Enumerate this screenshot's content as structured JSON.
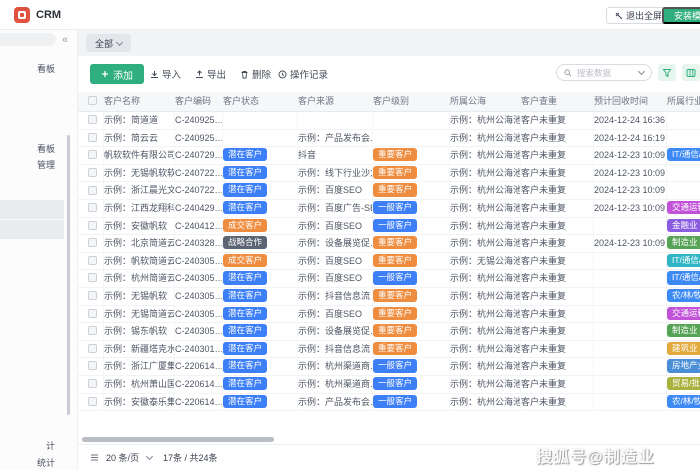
{
  "topbar": {
    "app_name": "CRM",
    "exit_fullscreen": "退出全屏",
    "install_template": "安装模板"
  },
  "tabs": {
    "active": "全部"
  },
  "sidebar": {
    "items": [
      "看板",
      "看板",
      "管理",
      "计",
      "统计"
    ]
  },
  "toolbar": {
    "add": "添加",
    "import": "导入",
    "export": "导出",
    "delete": "删除",
    "history": "操作记录"
  },
  "search": {
    "placeholder": "搜索数据"
  },
  "colors": {
    "primary_green": "#2fae7f",
    "logo_red": "#e0523f",
    "status_potential": "#3d7ff7",
    "status_deal": "#ee8c3f",
    "status_strategic": "#5a6472",
    "level_important": "#ee8c3f",
    "level_general": "#3d7ff7"
  },
  "table": {
    "headers": [
      "客户名称",
      "客户编码",
      "客户状态",
      "客户来源",
      "客户级别",
      "所属公海",
      "客户查重",
      "预计回收时间",
      "所属行业"
    ],
    "rows": [
      {
        "name": "示例：简道道",
        "code": "C-240925…",
        "status": "",
        "status_color": "",
        "source": "",
        "level": "",
        "level_color": "",
        "pool": "示例：杭州公海池",
        "dup": "客户未重复",
        "time": "2024-12-24 16:36…",
        "industry": "",
        "industry_color": ""
      },
      {
        "name": "示例：简云云",
        "code": "C-240925…",
        "status": "",
        "status_color": "",
        "source": "示例：产品发布会…",
        "level": "",
        "level_color": "",
        "pool": "示例：杭州公海池",
        "dup": "客户未重复",
        "time": "2024-12-24 16:19…",
        "industry": "",
        "industry_color": ""
      },
      {
        "name": "帆软软件有限公司",
        "code": "C-240729…",
        "status": "潜在客户",
        "status_color": "#3d7ff7",
        "source": "抖音",
        "level": "重要客户",
        "level_color": "#ee8c3f",
        "pool": "示例：杭州公海池",
        "dup": "客户未重复",
        "time": "2024-12-23 10:09…",
        "industry": "IT/通信/",
        "industry_color": "#3d8af5"
      },
      {
        "name": "示例：无锡帆软软件",
        "code": "C-240722…",
        "status": "潜在客户",
        "status_color": "#3d7ff7",
        "source": "示例：线下行业沙龙",
        "level": "重要客户",
        "level_color": "#ee8c3f",
        "pool": "示例：杭州公海池",
        "dup": "客户未重复",
        "time": "2024-12-23 10:09…",
        "industry": "",
        "industry_color": ""
      },
      {
        "name": "示例：浙江晨光文…",
        "code": "C-240722…",
        "status": "潜在客户",
        "status_color": "#3d7ff7",
        "source": "示例：百度SEO",
        "level": "重要客户",
        "level_color": "#ee8c3f",
        "pool": "示例：杭州公海池",
        "dup": "客户未重复",
        "time": "2024-12-23 10:09…",
        "industry": "",
        "industry_color": ""
      },
      {
        "name": "示例：江西龙翔科…",
        "code": "C-240429…",
        "status": "潜在客户",
        "status_color": "#3d7ff7",
        "source": "示例：百度广告-SEM",
        "level": "一般客户",
        "level_color": "#3d7ff7",
        "pool": "示例：杭州公海池",
        "dup": "客户未重复",
        "time": "2024-12-23 10:09…",
        "industry": "交通运输",
        "industry_color": "#c152d8"
      },
      {
        "name": "示例：安徽帆软",
        "code": "C-240412…",
        "status": "成交客户",
        "status_color": "#ee8c3f",
        "source": "示例：百度SEO",
        "level": "一般客户",
        "level_color": "#3d7ff7",
        "pool": "示例：杭州公海池",
        "dup": "客户未重复",
        "time": "",
        "industry": "金融业",
        "industry_color": "#8a5ce0"
      },
      {
        "name": "示例：北京简道云…",
        "code": "C-240328…",
        "status": "战略合作",
        "status_color": "#5a6472",
        "source": "示例：设备展览促…",
        "level": "重要客户",
        "level_color": "#ee8c3f",
        "pool": "示例：杭州公海池",
        "dup": "客户未重复",
        "time": "2024-12-23 10:09…",
        "industry": "制造业",
        "industry_color": "#55a355"
      },
      {
        "name": "示例：帆软简道云",
        "code": "C-240305…",
        "status": "成交客户",
        "status_color": "#ee8c3f",
        "source": "示例：百度SEO",
        "level": "重要客户",
        "level_color": "#ee8c3f",
        "pool": "示例：无锡公海池",
        "dup": "客户未重复",
        "time": "",
        "industry": "IT/通信/",
        "industry_color": "#2fb5c4"
      },
      {
        "name": "示例：杭州简道云",
        "code": "C-240305…",
        "status": "潜在客户",
        "status_color": "#3d7ff7",
        "source": "示例：百度SEO",
        "level": "一般客户",
        "level_color": "#3d7ff7",
        "pool": "示例：杭州公海池",
        "dup": "客户未重复",
        "time": "",
        "industry": "IT/通信/",
        "industry_color": "#3d8af5"
      },
      {
        "name": "示例：无锡帆软",
        "code": "C-240305…",
        "status": "潜在客户",
        "status_color": "#3d7ff7",
        "source": "示例：抖音信息流",
        "level": "重要客户",
        "level_color": "#ee8c3f",
        "pool": "示例：杭州公海池",
        "dup": "客户未重复",
        "time": "",
        "industry": "农/林/牧",
        "industry_color": "#3d8af5"
      },
      {
        "name": "示例：无锡简道云",
        "code": "C-240305…",
        "status": "潜在客户",
        "status_color": "#3d7ff7",
        "source": "示例：百度SEO",
        "level": "重要客户",
        "level_color": "#ee8c3f",
        "pool": "示例：杭州公海池",
        "dup": "客户未重复",
        "time": "",
        "industry": "交通运输",
        "industry_color": "#c152d8"
      },
      {
        "name": "示例：锡东帆软",
        "code": "C-240305…",
        "status": "潜在客户",
        "status_color": "#3d7ff7",
        "source": "示例：设备展览促…",
        "level": "重要客户",
        "level_color": "#ee8c3f",
        "pool": "示例：杭州公海池",
        "dup": "客户未重复",
        "time": "",
        "industry": "制造业",
        "industry_color": "#55a355"
      },
      {
        "name": "示例：新疆塔克水…",
        "code": "C-240301…",
        "status": "潜在客户",
        "status_color": "#3d7ff7",
        "source": "示例：抖音信息流",
        "level": "重要客户",
        "level_color": "#ee8c3f",
        "pool": "示例：杭州公海池",
        "dup": "客户未重复",
        "time": "",
        "industry": "建筑业",
        "industry_color": "#e2a93c"
      },
      {
        "name": "示例：浙江广厦集团",
        "code": "C-220614…",
        "status": "潜在客户",
        "status_color": "#3d7ff7",
        "source": "示例：杭州渠道商…",
        "level": "一般客户",
        "level_color": "#3d7ff7",
        "pool": "示例：杭州公海池",
        "dup": "客户未重复",
        "time": "",
        "industry": "房地产业",
        "industry_color": "#4a8fd6"
      },
      {
        "name": "示例：杭州萧山国…",
        "code": "C-220614…",
        "status": "潜在客户",
        "status_color": "#3d7ff7",
        "source": "示例：杭州渠道商…",
        "level": "一般客户",
        "level_color": "#3d7ff7",
        "pool": "示例：杭州公海池",
        "dup": "客户未重复",
        "time": "",
        "industry": "贸易/批发",
        "industry_color": "#aab23e"
      },
      {
        "name": "示例：安徽泰乐集团",
        "code": "C-220614…",
        "status": "潜在客户",
        "status_color": "#3d7ff7",
        "source": "示例：产品发布会…",
        "level": "一般客户",
        "level_color": "#3d7ff7",
        "pool": "示例：杭州公海池",
        "dup": "客户未重复",
        "time": "",
        "industry": "农/林/牧",
        "industry_color": "#3d8af5"
      }
    ]
  },
  "pagination": {
    "page_size": "20 条/页",
    "total": "17条 / 共24条"
  },
  "watermark": "搜狐号@制造业"
}
